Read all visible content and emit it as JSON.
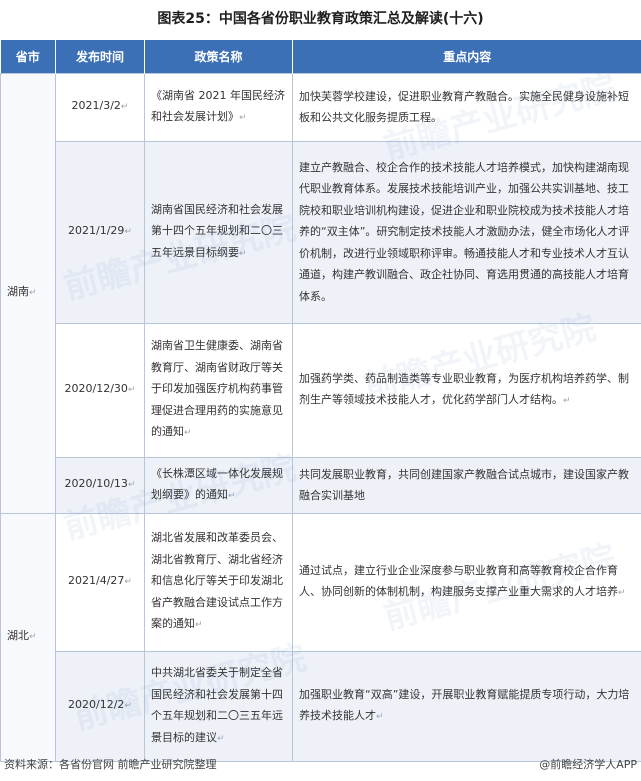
{
  "title": "图表25：中国各省份职业教育政策汇总及解读(十六)",
  "headers": {
    "province": "省市",
    "date": "发布时间",
    "name": "政策名称",
    "content": "重点内容"
  },
  "rows": [
    {
      "province": "湖南",
      "date": "2021/3/2",
      "name": "《湖南省 2021 年国民经济和社会发展计划》",
      "content": "加快芙蓉学校建设，促进职业教育产教融合。实施全民健身设施补短板和公共文化服务提质工程。"
    },
    {
      "province": "",
      "date": "2021/1/29",
      "name": "湖南省国民经济和社会发展第十四个五年规划和二〇三五年远景目标纲要",
      "content": "建立产教融合、校企合作的技术技能人才培养模式，加快构建湖南现代职业教育体系。发展技术技能培训产业，加强公共实训基地、技工院校和职业培训机构建设，促进企业和职业院校成为技术技能人才培养的“双主体”。研究制定技术技能人才激励办法，健全市场化人才评价机制，改进行业领域职称评审。畅通技能人才和专业技术人才互认通道，构建产教训融合、政企社协同、育选用贯通的高技能人才培育体系。"
    },
    {
      "province": "",
      "date": "2020/12/30",
      "name": "湖南省卫生健康委、湖南省教育厅、湖南省财政厅等关于印发加强医疗机构药事管理促进合理用药的实施意见的通知",
      "content": "加强药学类、药品制造类等专业职业教育，为医疗机构培养药学、制剂生产等领域技术技能人才，优化药学部门人才结构。"
    },
    {
      "province": "",
      "date": "2020/10/13",
      "name": "《长株潭区域一体化发展规划纲要》的通知",
      "content": "共同发展职业教育，共同创建国家产教融合试点城市，建设国家产教融合实训基地"
    },
    {
      "province": "湖北",
      "date": "2021/4/27",
      "name": "湖北省发展和改革委员会、湖北省教育厅、湖北省经济和信息化厅等关于印发湖北省产教融合建设试点工作方案的通知",
      "content": "通过试点，建立行业企业深度参与职业教育和高等教育校企合作育人、协同创新的体制机制，构建服务支撑产业重大需求的人才培养"
    },
    {
      "province": "",
      "date": "2020/12/2",
      "name": "中共湖北省委关于制定全省国民经济和社会发展第十四个五年规划和二〇三五年远景目标的建议",
      "content": "加强职业教育“双高”建设，开展职业教育赋能提质专项行动，大力培养技术技能人才"
    }
  ],
  "watermark": "前瞻产业研究院",
  "footer": {
    "source": "资料来源：各省份官网 前瞻产业研究院整理",
    "brand": "@前瞻经济学人APP"
  },
  "colors": {
    "header_bg": "#3b6fb6",
    "border": "#b7c6db"
  }
}
